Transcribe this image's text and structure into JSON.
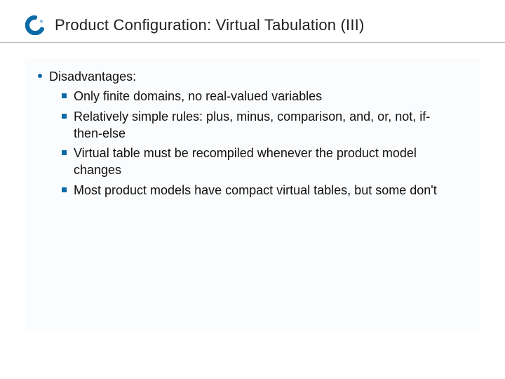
{
  "header": {
    "title": "Product Configuration: Virtual Tabulation (III)",
    "logo_color_primary": "#0b6aa8",
    "logo_color_accent": "#8fbfe0"
  },
  "content": {
    "heading": "Disadvantages:",
    "items": [
      "Only finite domains, no real-valued variables",
      "Relatively simple rules: plus, minus, comparison, and, or, not, if-then-else",
      "Virtual table must be recompiled whenever the product model changes",
      "Most product models have compact virtual tables, but some don't"
    ]
  }
}
